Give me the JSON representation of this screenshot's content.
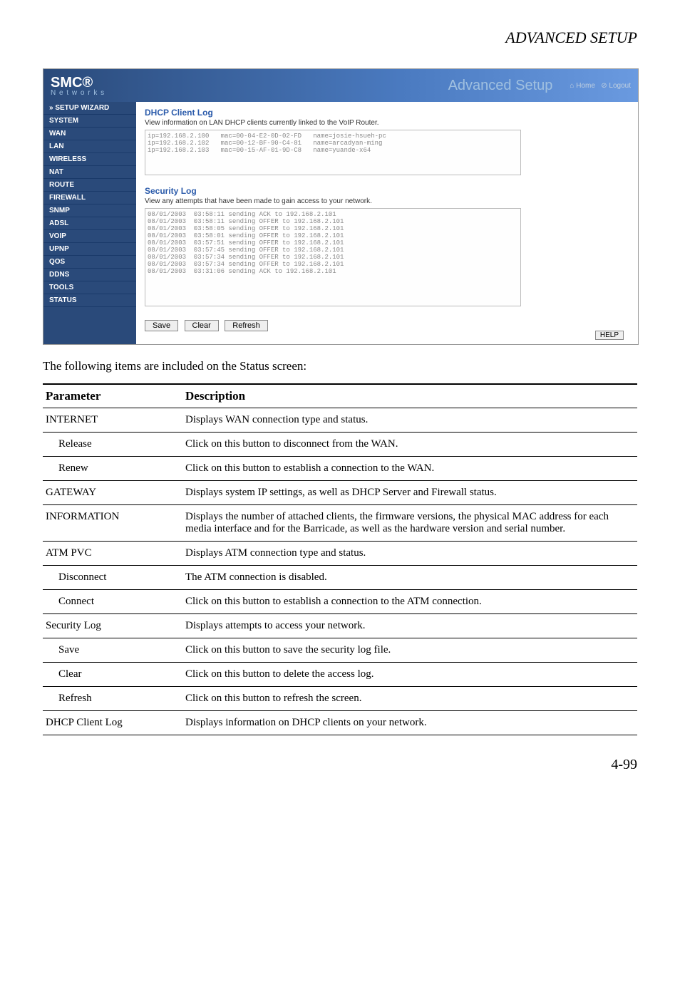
{
  "page_title": "ADVANCED SETUP",
  "screenshot": {
    "logo": "SMC®",
    "logo_sub": "N e t w o r k s",
    "header_right": "Advanced Setup",
    "home_link": "Home",
    "logout_link": "Logout",
    "sidebar": [
      "» SETUP WIZARD",
      "SYSTEM",
      "WAN",
      "LAN",
      "WIRELESS",
      "NAT",
      "ROUTE",
      "FIREWALL",
      "SNMP",
      "ADSL",
      "VoIP",
      "UPnP",
      "QoS",
      "DDNS",
      "TOOLS",
      "STATUS"
    ],
    "dhcp_title": "DHCP Client Log",
    "dhcp_sub": "View information on LAN DHCP clients currently linked to the VoIP Router.",
    "dhcp_log": "ip=192.168.2.100   mac=00-04-E2-0D-02-FD   name=josie-hsueh-pc\nip=192.168.2.102   mac=00-12-BF-90-C4-81   name=arcadyan-ming\nip=192.168.2.103   mac=00-15-AF-01-9D-C8   name=yuande-x64",
    "sec_title": "Security Log",
    "sec_sub": "View any attempts that have been made to gain access to your network.",
    "sec_log": "08/01/2003  03:58:11 sending ACK to 192.168.2.101\n08/01/2003  03:58:11 sending OFFER to 192.168.2.101\n08/01/2003  03:58:05 sending OFFER to 192.168.2.101\n08/01/2003  03:58:01 sending OFFER to 192.168.2.101\n08/01/2003  03:57:51 sending OFFER to 192.168.2.101\n08/01/2003  03:57:45 sending OFFER to 192.168.2.101\n08/01/2003  03:57:34 sending OFFER to 192.168.2.101\n08/01/2003  03:57:34 sending OFFER to 192.168.2.101\n08/01/2003  03:31:06 sending ACK to 192.168.2.101",
    "btn_save": "Save",
    "btn_clear": "Clear",
    "btn_refresh": "Refresh",
    "btn_help": "HELP"
  },
  "caption": "The following items are included on the Status screen:",
  "table_headers": {
    "param": "Parameter",
    "desc": "Description"
  },
  "rows": [
    {
      "param": "INTERNET",
      "desc": "Displays WAN connection type and status.",
      "indent": false
    },
    {
      "param": "Release",
      "desc": "Click on this button to disconnect from the WAN.",
      "indent": true
    },
    {
      "param": "Renew",
      "desc": "Click on this button to establish a connection to the WAN.",
      "indent": true
    },
    {
      "param": "GATEWAY",
      "desc": "Displays system IP settings, as well as DHCP Server and Firewall status.",
      "indent": false
    },
    {
      "param": "INFORMATION",
      "desc": "Displays the number of attached clients, the firmware versions, the physical MAC address for each media interface and for the Barricade, as well as the hardware version and serial number.",
      "indent": false
    },
    {
      "param": "ATM PVC",
      "desc": "Displays ATM connection type and status.",
      "indent": false
    },
    {
      "param": "Disconnect",
      "desc": "The ATM connection is disabled.",
      "indent": true
    },
    {
      "param": "Connect",
      "desc": "Click on this button to establish a connection to the ATM connection.",
      "indent": true
    },
    {
      "param": "Security Log",
      "desc": "Displays attempts to access your network.",
      "indent": false
    },
    {
      "param": "Save",
      "desc": "Click on this button to save the security log file.",
      "indent": true
    },
    {
      "param": "Clear",
      "desc": "Click on this button to delete the access log.",
      "indent": true
    },
    {
      "param": "Refresh",
      "desc": "Click on this button to refresh the screen.",
      "indent": true
    },
    {
      "param": "DHCP Client Log",
      "desc": "Displays information on DHCP clients on your network.",
      "indent": false
    }
  ],
  "page_number": "4-99"
}
